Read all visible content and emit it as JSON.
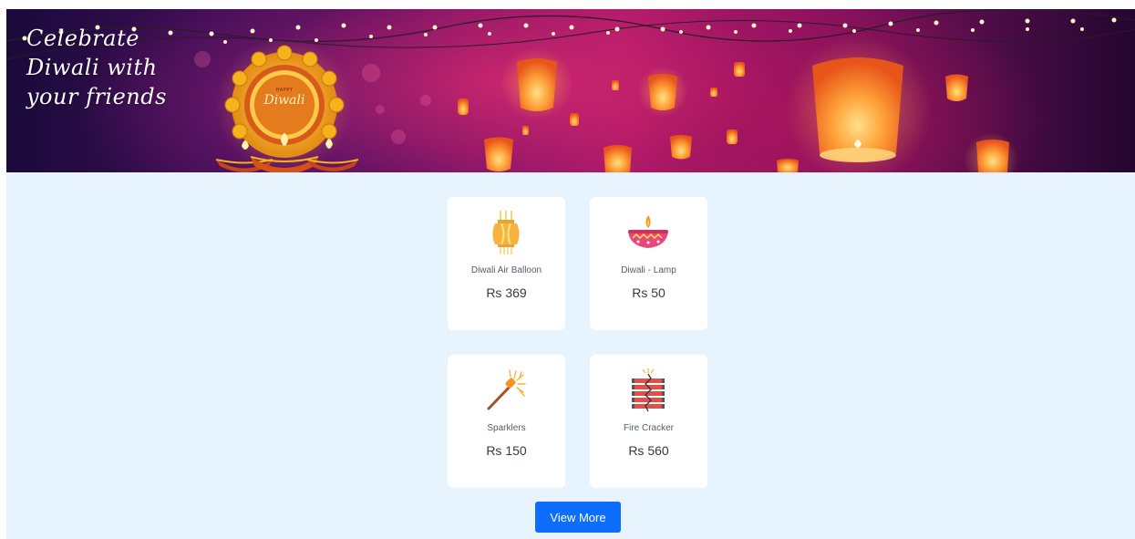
{
  "banner": {
    "lines": [
      "Celebrate",
      "Diwali with",
      "your friends"
    ],
    "badge_top": "HAPPY",
    "badge_main": "Diwali"
  },
  "products": [
    {
      "name": "Diwali Air Balloon",
      "price": "Rs 369",
      "icon": "lantern-icon"
    },
    {
      "name": "Diwali - Lamp",
      "price": "Rs 50",
      "icon": "diya-lamp-icon"
    },
    {
      "name": "Sparklers",
      "price": "Rs 150",
      "icon": "sparkler-icon"
    },
    {
      "name": "Fire Cracker",
      "price": "Rs 560",
      "icon": "fire-cracker-icon"
    }
  ],
  "view_more_label": "View More",
  "colors": {
    "page_bg": "#e7f4fd",
    "card_bg": "#ffffff",
    "button": "#0d6efd",
    "accent_orange": "#f7931e"
  }
}
